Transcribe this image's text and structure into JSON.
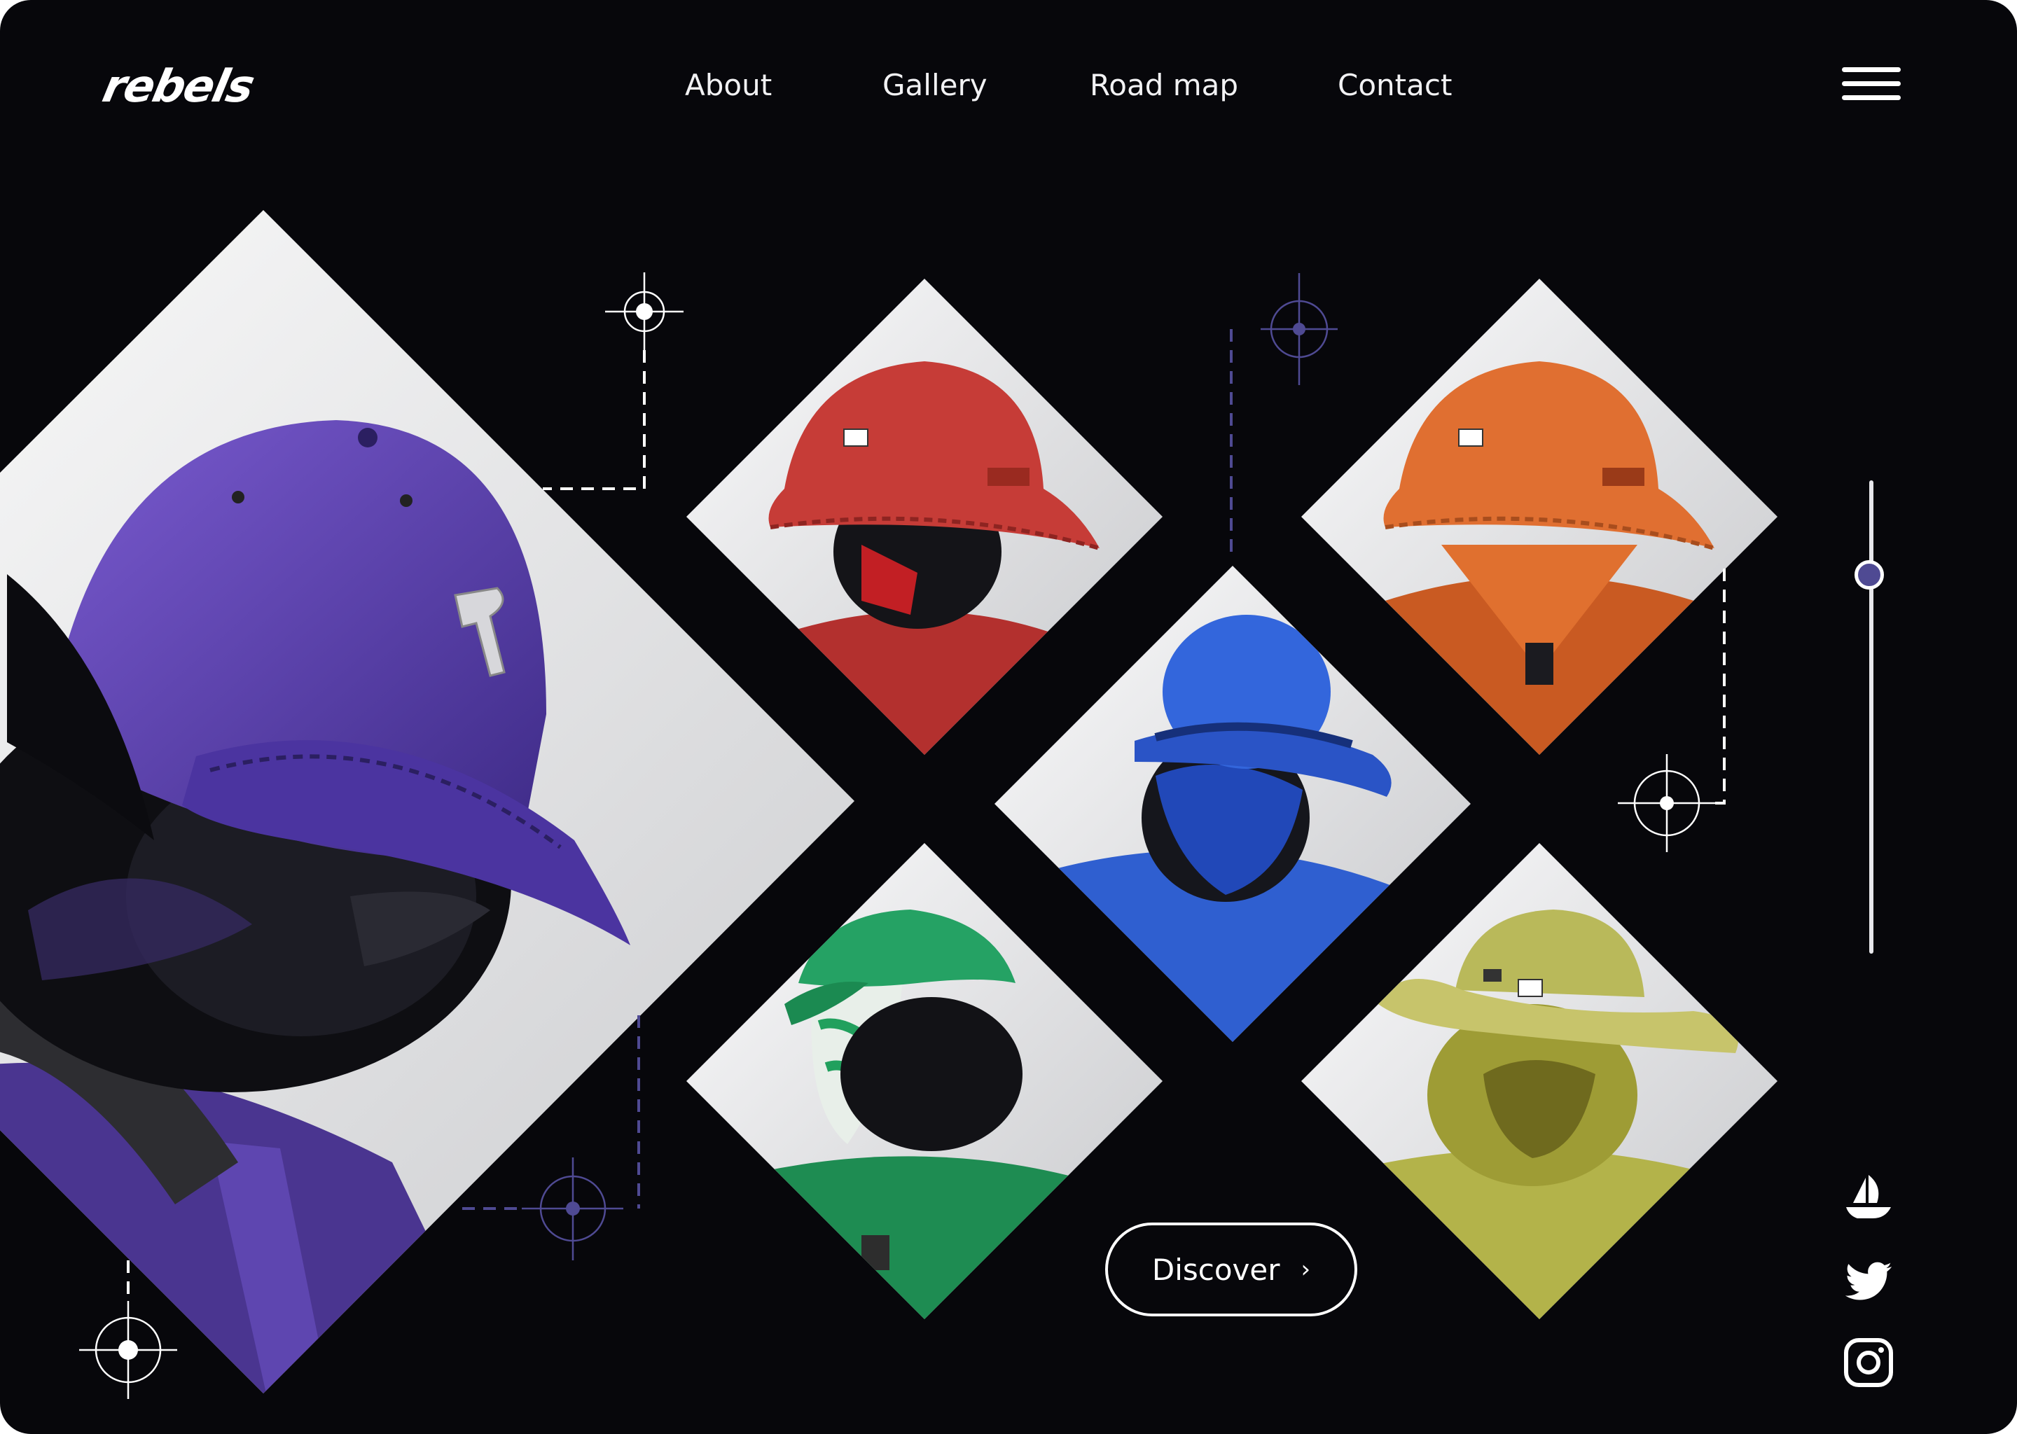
{
  "brand": {
    "logo_text": "rebels"
  },
  "nav": {
    "items": [
      "About",
      "Gallery",
      "Road map",
      "Contact"
    ]
  },
  "hero": {
    "discover_label": "Discover"
  },
  "gallery": {
    "featured": {
      "hat": "purple baseball cap"
    },
    "tiles": [
      {
        "hat": "red bucket hat"
      },
      {
        "hat": "orange bucket hat"
      },
      {
        "hat": "blue bowler hat"
      },
      {
        "hat": "green baseball cap"
      },
      {
        "hat": "olive cowboy hat"
      }
    ]
  },
  "slider": {
    "value_fraction": 0.2
  },
  "social": {
    "icons": [
      "opensea-icon",
      "twitter-icon",
      "instagram-icon"
    ]
  },
  "colors": {
    "background": "#07070b",
    "accent": "#4f4a93",
    "text": "#ffffff",
    "purple_cap": "#5b3fa8",
    "red": "#c23a36",
    "orange": "#e06a2d",
    "blue": "#2f5fd0",
    "green": "#1e9a5a",
    "olive": "#b7b64e"
  }
}
